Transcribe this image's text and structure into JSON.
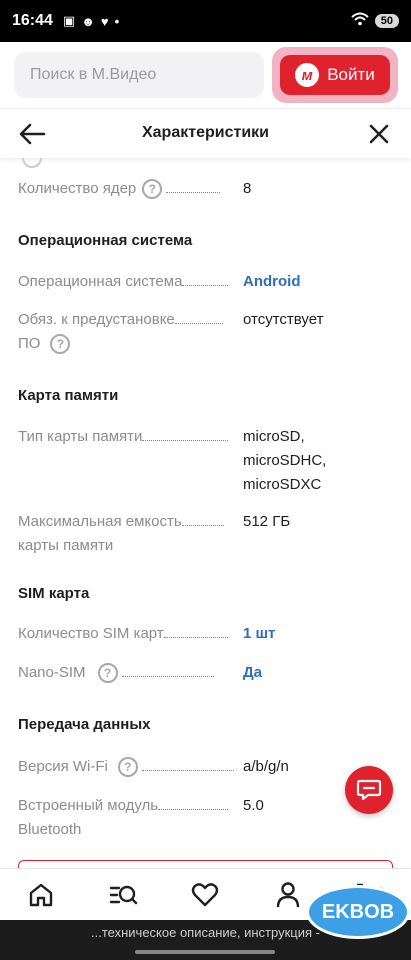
{
  "status_bar": {
    "time": "16:44",
    "icons": [
      "notification-icon",
      "message-icon",
      "heart-icon",
      "dot-icon"
    ],
    "battery": "50"
  },
  "header": {
    "search_placeholder": "Поиск в М.Видео",
    "login_label": "Войти",
    "logo_letter": "м",
    "accent": "#e0222e"
  },
  "sheet": {
    "title": "Характеристики"
  },
  "specs": {
    "cores": {
      "label": "Количество ядер",
      "value": "8"
    },
    "os_section": "Операционная система",
    "os": {
      "label": "Операционная система",
      "value": "Android"
    },
    "preinstall": {
      "label_line1": "Обяз. к предустановке",
      "label_line2": "ПО",
      "value": "отсутствует"
    },
    "memcard_section": "Карта памяти",
    "memcard_type": {
      "label": "Тип карты памяти",
      "value_line1": "microSD,",
      "value_line2": "microSDHC,",
      "value_line3": "microSDXC"
    },
    "memcard_max": {
      "label_line1": "Максимальная емкость",
      "label_line2": "карты памяти",
      "value": "512 ГБ"
    },
    "sim_section": "SIM карта",
    "sim_count": {
      "label": "Количество SIM карт",
      "value": "1 шт"
    },
    "nano_sim": {
      "label": "Nano-SIM",
      "value": "Да"
    },
    "data_section": "Передача данных",
    "wifi": {
      "label": "Версия Wi-Fi",
      "value": "a/b/g/n"
    },
    "bluetooth": {
      "label_line1": "Встроенный модуль",
      "label_line2": "Bluetooth",
      "value": "5.0"
    }
  },
  "nav": {
    "items": [
      "home-icon",
      "catalog-search-icon",
      "favorites-icon",
      "profile-icon",
      "cart-icon"
    ]
  },
  "footer_hint": "...техническое описание, инструкция -",
  "watermark": "EKBOB"
}
